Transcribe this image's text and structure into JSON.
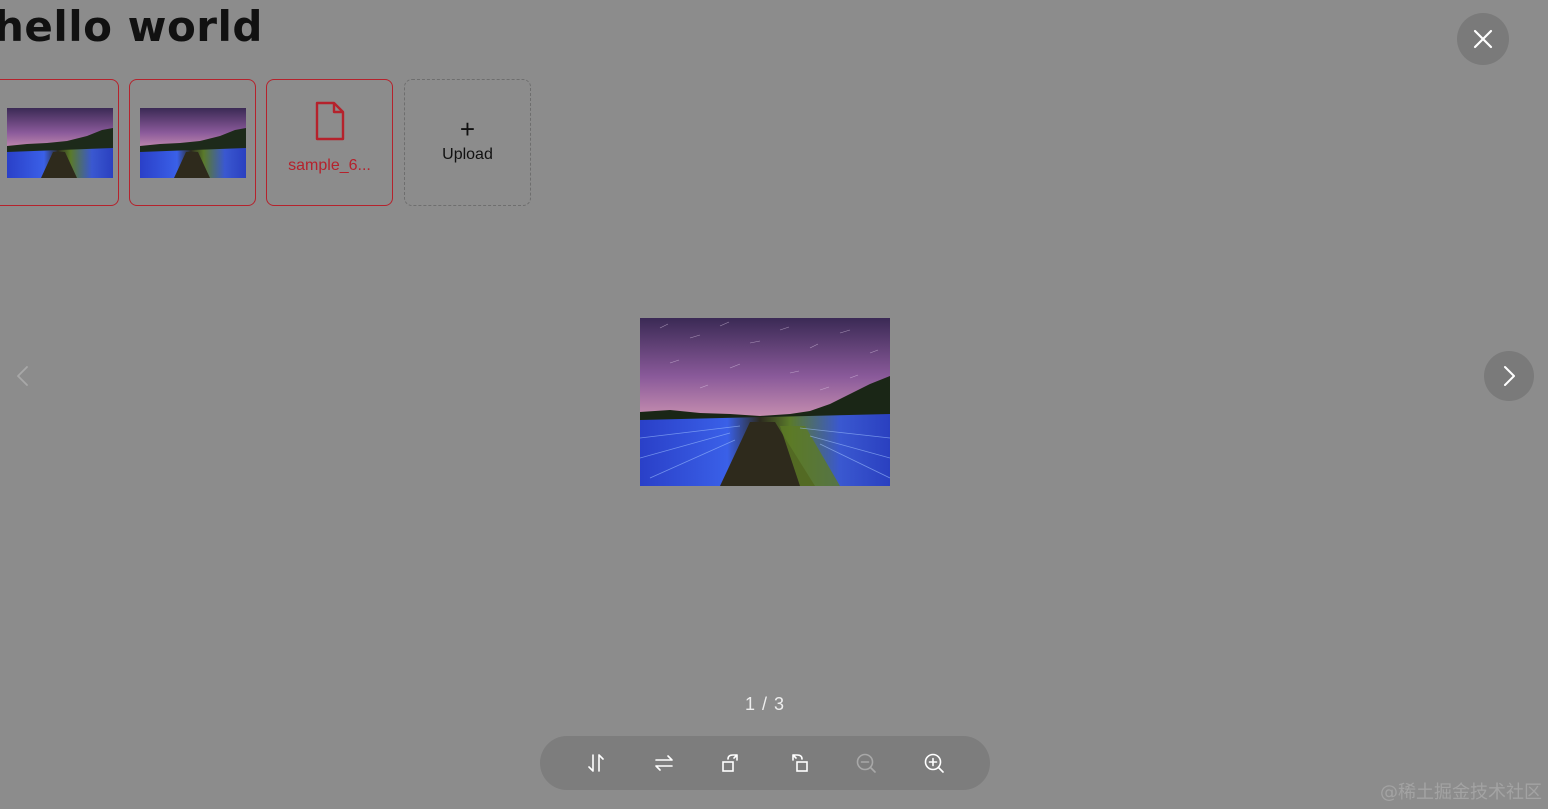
{
  "page": {
    "title": "hello world"
  },
  "upload_list": {
    "items": [
      {
        "type": "image"
      },
      {
        "type": "image"
      },
      {
        "type": "file",
        "name": "sample_6..."
      }
    ],
    "upload_button": {
      "icon": "plus-icon",
      "label": "Upload"
    }
  },
  "preview": {
    "counter": "1 / 3",
    "close_icon": "close-icon",
    "prev_icon": "chevron-left-icon",
    "next_icon": "chevron-right-icon",
    "toolbar": [
      {
        "name": "flip-vertical-icon",
        "enabled": true
      },
      {
        "name": "flip-horizontal-icon",
        "enabled": true
      },
      {
        "name": "rotate-right-icon",
        "enabled": true
      },
      {
        "name": "rotate-left-icon",
        "enabled": true
      },
      {
        "name": "zoom-out-icon",
        "enabled": false
      },
      {
        "name": "zoom-in-icon",
        "enabled": true
      }
    ]
  },
  "watermark": "@稀土掘金技术社区",
  "colors": {
    "mask": "#8c8c8c",
    "danger": "#b5222c",
    "control_bg": "#7a7a7a",
    "icon": "#ffffff",
    "icon_disabled": "#a8a8a8"
  }
}
